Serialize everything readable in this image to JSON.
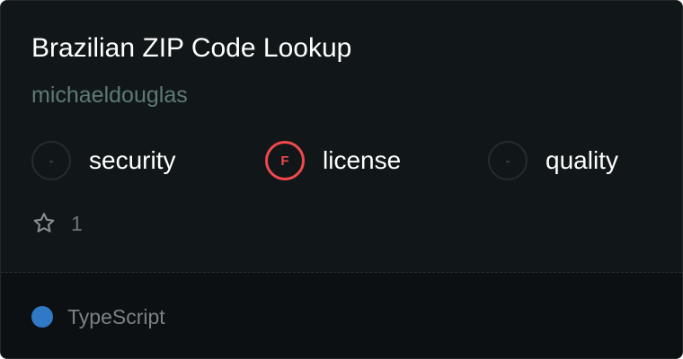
{
  "package": {
    "title": "Brazilian ZIP Code Lookup",
    "author": "michaeldouglas"
  },
  "grades": [
    {
      "label": "security",
      "grade": "-"
    },
    {
      "label": "license",
      "grade": "F"
    },
    {
      "label": "quality",
      "grade": "-"
    }
  ],
  "stats": {
    "stars": "1",
    "star_icon": "star-outline-icon"
  },
  "language": {
    "name": "TypeScript",
    "color": "#3178c6"
  },
  "colors": {
    "card_background": "#111719",
    "footer_background": "#0c1012",
    "author_text": "#5f7a74",
    "grade_f": "#f0484e"
  }
}
